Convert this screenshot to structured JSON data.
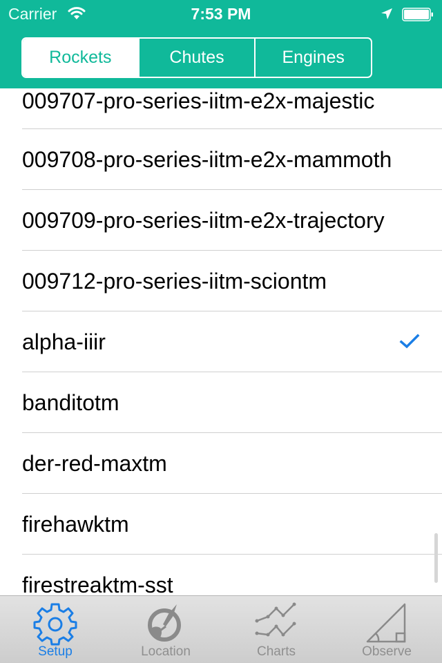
{
  "status_bar": {
    "carrier": "Carrier",
    "time": "7:53 PM",
    "icons": [
      "wifi-icon",
      "location-arrow-icon",
      "battery-icon"
    ]
  },
  "segmented_control": {
    "selected": "Rockets",
    "segments": [
      {
        "label": "Rockets",
        "active": true
      },
      {
        "label": "Chutes",
        "active": false
      },
      {
        "label": "Engines",
        "active": false
      }
    ]
  },
  "list": {
    "items": [
      {
        "label": "009707-pro-series-iitm-e2x-majestic",
        "checked": false
      },
      {
        "label": "009708-pro-series-iitm-e2x-mammoth",
        "checked": false
      },
      {
        "label": "009709-pro-series-iitm-e2x-trajectory",
        "checked": false
      },
      {
        "label": "009712-pro-series-iitm-sciontm",
        "checked": false
      },
      {
        "label": "alpha-iiir",
        "checked": true
      },
      {
        "label": "banditotm",
        "checked": false
      },
      {
        "label": "der-red-maxtm",
        "checked": false
      },
      {
        "label": "firehawktm",
        "checked": false
      },
      {
        "label": "firestreaktm-sst",
        "checked": false
      }
    ],
    "selected_item": "alpha-iiir"
  },
  "tab_bar": {
    "tabs": [
      {
        "label": "Setup",
        "icon": "gear-icon",
        "active": true
      },
      {
        "label": "Location",
        "icon": "rocket-globe-icon",
        "active": false
      },
      {
        "label": "Charts",
        "icon": "line-chart-icon",
        "active": false
      },
      {
        "label": "Observe",
        "icon": "triangle-angle-icon",
        "active": false
      }
    ]
  },
  "colors": {
    "brand_teal": "#10b99a",
    "active_blue": "#1a7ee6",
    "inactive_gray": "#8f8f8f"
  }
}
